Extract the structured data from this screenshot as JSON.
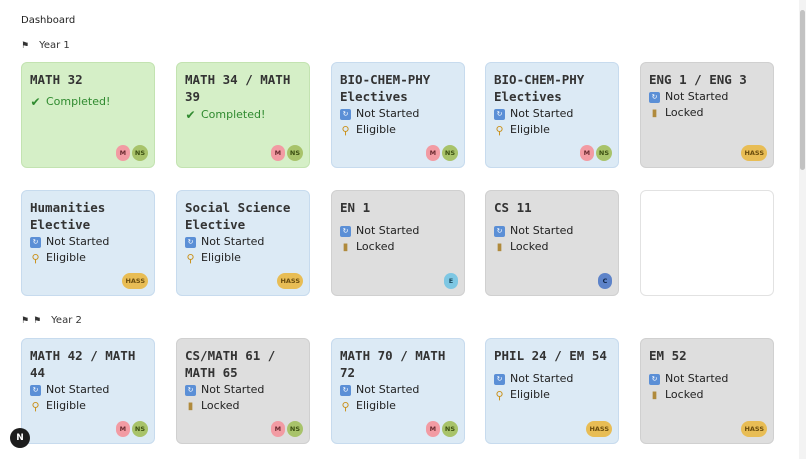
{
  "breadcrumb": "Dashboard",
  "years": [
    {
      "label": "Year 1"
    },
    {
      "label": "Year 2"
    }
  ],
  "status_labels": {
    "completed": "Completed!",
    "not_started": "Not Started",
    "eligible": "Eligible",
    "locked": "Locked"
  },
  "tag_labels": {
    "m": "M",
    "ns": "NS",
    "hass": "HASS",
    "e": "E",
    "c": "C"
  },
  "cards": [
    {
      "title": "MATH 32"
    },
    {
      "title": "MATH 34 / MATH 39"
    },
    {
      "title": "BIO-CHEM-PHY Electives"
    },
    {
      "title": "BIO-CHEM-PHY Electives"
    },
    {
      "title": "ENG 1 / ENG 3"
    },
    {
      "title": "Humanities Elective"
    },
    {
      "title": "Social Science Elective"
    },
    {
      "title": "EN 1"
    },
    {
      "title": "CS 11"
    },
    {
      "title": ""
    },
    {
      "title": "MATH 42 / MATH 44"
    },
    {
      "title": "CS/MATH 61 / MATH 65"
    },
    {
      "title": "MATH 70 / MATH 72"
    },
    {
      "title": "PHIL 24 / EM 54"
    },
    {
      "title": "EM 52"
    }
  ],
  "fab_label": "N",
  "colors": {
    "completed": "#d5efc7",
    "eligible": "#dceaf5",
    "locked": "#dedede",
    "tag_m": "#f29ba3",
    "tag_ns": "#a8c36a",
    "tag_hass": "#e8bd55",
    "tag_e": "#7ec7e3",
    "tag_c": "#5d83c9"
  }
}
